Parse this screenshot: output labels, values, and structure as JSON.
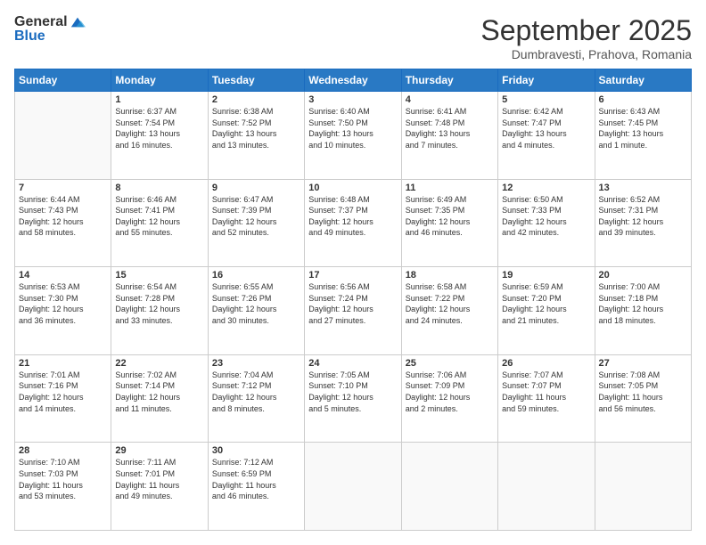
{
  "logo": {
    "general": "General",
    "blue": "Blue"
  },
  "header": {
    "month": "September 2025",
    "location": "Dumbravesti, Prahova, Romania"
  },
  "weekdays": [
    "Sunday",
    "Monday",
    "Tuesday",
    "Wednesday",
    "Thursday",
    "Friday",
    "Saturday"
  ],
  "weeks": [
    [
      {
        "day": "",
        "info": ""
      },
      {
        "day": "1",
        "info": "Sunrise: 6:37 AM\nSunset: 7:54 PM\nDaylight: 13 hours\nand 16 minutes."
      },
      {
        "day": "2",
        "info": "Sunrise: 6:38 AM\nSunset: 7:52 PM\nDaylight: 13 hours\nand 13 minutes."
      },
      {
        "day": "3",
        "info": "Sunrise: 6:40 AM\nSunset: 7:50 PM\nDaylight: 13 hours\nand 10 minutes."
      },
      {
        "day": "4",
        "info": "Sunrise: 6:41 AM\nSunset: 7:48 PM\nDaylight: 13 hours\nand 7 minutes."
      },
      {
        "day": "5",
        "info": "Sunrise: 6:42 AM\nSunset: 7:47 PM\nDaylight: 13 hours\nand 4 minutes."
      },
      {
        "day": "6",
        "info": "Sunrise: 6:43 AM\nSunset: 7:45 PM\nDaylight: 13 hours\nand 1 minute."
      }
    ],
    [
      {
        "day": "7",
        "info": "Sunrise: 6:44 AM\nSunset: 7:43 PM\nDaylight: 12 hours\nand 58 minutes."
      },
      {
        "day": "8",
        "info": "Sunrise: 6:46 AM\nSunset: 7:41 PM\nDaylight: 12 hours\nand 55 minutes."
      },
      {
        "day": "9",
        "info": "Sunrise: 6:47 AM\nSunset: 7:39 PM\nDaylight: 12 hours\nand 52 minutes."
      },
      {
        "day": "10",
        "info": "Sunrise: 6:48 AM\nSunset: 7:37 PM\nDaylight: 12 hours\nand 49 minutes."
      },
      {
        "day": "11",
        "info": "Sunrise: 6:49 AM\nSunset: 7:35 PM\nDaylight: 12 hours\nand 46 minutes."
      },
      {
        "day": "12",
        "info": "Sunrise: 6:50 AM\nSunset: 7:33 PM\nDaylight: 12 hours\nand 42 minutes."
      },
      {
        "day": "13",
        "info": "Sunrise: 6:52 AM\nSunset: 7:31 PM\nDaylight: 12 hours\nand 39 minutes."
      }
    ],
    [
      {
        "day": "14",
        "info": "Sunrise: 6:53 AM\nSunset: 7:30 PM\nDaylight: 12 hours\nand 36 minutes."
      },
      {
        "day": "15",
        "info": "Sunrise: 6:54 AM\nSunset: 7:28 PM\nDaylight: 12 hours\nand 33 minutes."
      },
      {
        "day": "16",
        "info": "Sunrise: 6:55 AM\nSunset: 7:26 PM\nDaylight: 12 hours\nand 30 minutes."
      },
      {
        "day": "17",
        "info": "Sunrise: 6:56 AM\nSunset: 7:24 PM\nDaylight: 12 hours\nand 27 minutes."
      },
      {
        "day": "18",
        "info": "Sunrise: 6:58 AM\nSunset: 7:22 PM\nDaylight: 12 hours\nand 24 minutes."
      },
      {
        "day": "19",
        "info": "Sunrise: 6:59 AM\nSunset: 7:20 PM\nDaylight: 12 hours\nand 21 minutes."
      },
      {
        "day": "20",
        "info": "Sunrise: 7:00 AM\nSunset: 7:18 PM\nDaylight: 12 hours\nand 18 minutes."
      }
    ],
    [
      {
        "day": "21",
        "info": "Sunrise: 7:01 AM\nSunset: 7:16 PM\nDaylight: 12 hours\nand 14 minutes."
      },
      {
        "day": "22",
        "info": "Sunrise: 7:02 AM\nSunset: 7:14 PM\nDaylight: 12 hours\nand 11 minutes."
      },
      {
        "day": "23",
        "info": "Sunrise: 7:04 AM\nSunset: 7:12 PM\nDaylight: 12 hours\nand 8 minutes."
      },
      {
        "day": "24",
        "info": "Sunrise: 7:05 AM\nSunset: 7:10 PM\nDaylight: 12 hours\nand 5 minutes."
      },
      {
        "day": "25",
        "info": "Sunrise: 7:06 AM\nSunset: 7:09 PM\nDaylight: 12 hours\nand 2 minutes."
      },
      {
        "day": "26",
        "info": "Sunrise: 7:07 AM\nSunset: 7:07 PM\nDaylight: 11 hours\nand 59 minutes."
      },
      {
        "day": "27",
        "info": "Sunrise: 7:08 AM\nSunset: 7:05 PM\nDaylight: 11 hours\nand 56 minutes."
      }
    ],
    [
      {
        "day": "28",
        "info": "Sunrise: 7:10 AM\nSunset: 7:03 PM\nDaylight: 11 hours\nand 53 minutes."
      },
      {
        "day": "29",
        "info": "Sunrise: 7:11 AM\nSunset: 7:01 PM\nDaylight: 11 hours\nand 49 minutes."
      },
      {
        "day": "30",
        "info": "Sunrise: 7:12 AM\nSunset: 6:59 PM\nDaylight: 11 hours\nand 46 minutes."
      },
      {
        "day": "",
        "info": ""
      },
      {
        "day": "",
        "info": ""
      },
      {
        "day": "",
        "info": ""
      },
      {
        "day": "",
        "info": ""
      }
    ]
  ]
}
